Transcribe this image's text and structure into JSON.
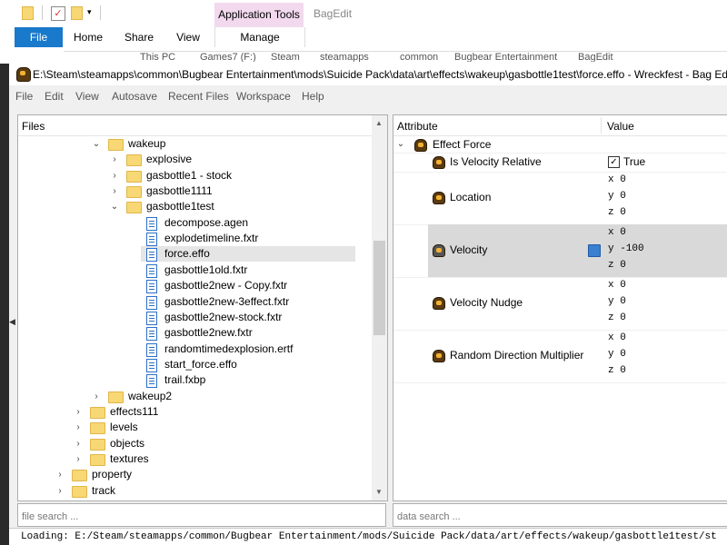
{
  "explorer": {
    "tabs": [
      "File",
      "Home",
      "Share",
      "View",
      "Manage"
    ],
    "context_tab": "Application Tools",
    "window_name": "BagEdit",
    "address": [
      "This PC",
      "Games7 (F:)",
      "Steam",
      "steamapps",
      "common",
      "Bugbear Entertainment",
      "BagEdit"
    ]
  },
  "window": {
    "title": "E:\\Steam\\steamapps\\common\\Bugbear Entertainment\\mods\\Suicide Pack\\data\\art\\effects\\wakeup\\gasbottle1test\\force.effo - Wreckfest - Bag Edit"
  },
  "menu": [
    "File",
    "Edit",
    "View",
    "Autosave",
    "Recent Files",
    "Workspace",
    "Help"
  ],
  "files": {
    "header": "Files",
    "tree": [
      {
        "label": "wakeup",
        "kind": "folder",
        "expanded": true,
        "level": 5
      },
      {
        "label": "explosive",
        "kind": "folder",
        "expanded": false,
        "level": 6
      },
      {
        "label": "gasbottle1 - stock",
        "kind": "folder",
        "expanded": false,
        "level": 6
      },
      {
        "label": "gasbottle1111",
        "kind": "folder",
        "expanded": false,
        "level": 6
      },
      {
        "label": "gasbottle1test",
        "kind": "folder",
        "expanded": true,
        "level": 6
      },
      {
        "label": "decompose.agen",
        "kind": "file",
        "level": 7
      },
      {
        "label": "explodetimeline.fxtr",
        "kind": "file",
        "level": 7
      },
      {
        "label": "force.effo",
        "kind": "file",
        "level": 7,
        "selected": true
      },
      {
        "label": "gasbottle1old.fxtr",
        "kind": "file",
        "level": 7
      },
      {
        "label": "gasbottle2new - Copy.fxtr",
        "kind": "file",
        "level": 7
      },
      {
        "label": "gasbottle2new-3effect.fxtr",
        "kind": "file",
        "level": 7
      },
      {
        "label": "gasbottle2new-stock.fxtr",
        "kind": "file",
        "level": 7
      },
      {
        "label": "gasbottle2new.fxtr",
        "kind": "file",
        "level": 7
      },
      {
        "label": "randomtimedexplosion.ertf",
        "kind": "file",
        "level": 7
      },
      {
        "label": "start_force.effo",
        "kind": "file",
        "level": 7
      },
      {
        "label": "trail.fxbp",
        "kind": "file",
        "level": 7
      },
      {
        "label": "wakeup2",
        "kind": "folder",
        "expanded": false,
        "level": 5
      },
      {
        "label": "effects111",
        "kind": "folder",
        "expanded": false,
        "level": 4
      },
      {
        "label": "levels",
        "kind": "folder",
        "expanded": false,
        "level": 4
      },
      {
        "label": "objects",
        "kind": "folder",
        "expanded": false,
        "level": 4
      },
      {
        "label": "textures",
        "kind": "folder",
        "expanded": false,
        "level": 4
      },
      {
        "label": "property",
        "kind": "folder",
        "expanded": false,
        "level": 3
      },
      {
        "label": "track",
        "kind": "folder",
        "expanded": false,
        "level": 3
      }
    ],
    "search_placeholder": "file search ..."
  },
  "attributes": {
    "col_attribute": "Attribute",
    "col_value": "Value",
    "root": "Effect Force",
    "velocity_relative": {
      "name": "Is Velocity Relative",
      "value": "True"
    },
    "location": {
      "name": "Location",
      "x": "x 0",
      "y": "y 0",
      "z": "z 0"
    },
    "velocity": {
      "name": "Velocity",
      "x": "x 0",
      "y": "y -100",
      "z": "z 0"
    },
    "velocity_nudge": {
      "name": "Velocity Nudge",
      "x": "x 0",
      "y": "y 0",
      "z": "z 0"
    },
    "random_dir": {
      "name": "Random Direction Multiplier",
      "x": "x 0",
      "y": "y 0",
      "z": "z 0"
    },
    "search_placeholder": "data search ..."
  },
  "status": "Loading: E:/Steam/steamapps/common/Bugbear Entertainment/mods/Suicide Pack/data/art/effects/wakeup/gasbottle1test/st"
}
